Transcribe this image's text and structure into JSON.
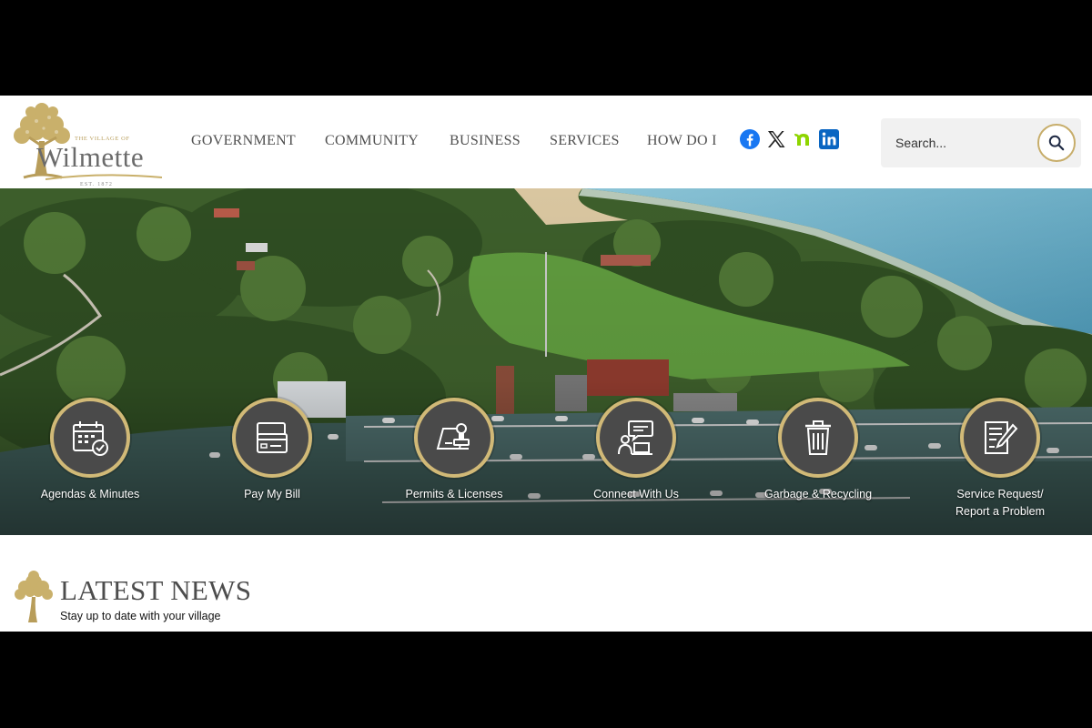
{
  "logo": {
    "village_of": "THE VILLAGE OF",
    "name": "Wilmette",
    "established": "EST. 1872"
  },
  "nav": {
    "items": [
      {
        "label": "GOVERNMENT"
      },
      {
        "label": "COMMUNITY"
      },
      {
        "label": "BUSINESS"
      },
      {
        "label": "SERVICES"
      },
      {
        "label": "HOW DO I"
      }
    ]
  },
  "social": {
    "icons": [
      "facebook-icon",
      "x-icon",
      "nextdoor-icon",
      "linkedin-icon"
    ],
    "colors": {
      "facebook": "#1877f2",
      "x": "#222222",
      "nextdoor": "#8ed500",
      "linkedin": "#0a66c2"
    }
  },
  "search": {
    "placeholder": "Search..."
  },
  "quick_links": [
    {
      "label": "Agendas & Minutes",
      "icon": "calendar-check-icon"
    },
    {
      "label": "Pay My Bill",
      "icon": "credit-card-icon"
    },
    {
      "label": "Permits & Licenses",
      "icon": "stamp-document-icon"
    },
    {
      "label": "Connect With Us",
      "icon": "chat-person-laptop-icon"
    },
    {
      "label": "Garbage & Recycling",
      "icon": "trash-can-icon"
    },
    {
      "label": "Service Request/",
      "label_line2": "Report a Problem",
      "icon": "edit-document-icon"
    }
  ],
  "news": {
    "title": "LATEST NEWS",
    "subtitle": "Stay up to date with your village"
  },
  "theme": {
    "gold": "#c7ad6a",
    "text_gray": "#505050"
  }
}
